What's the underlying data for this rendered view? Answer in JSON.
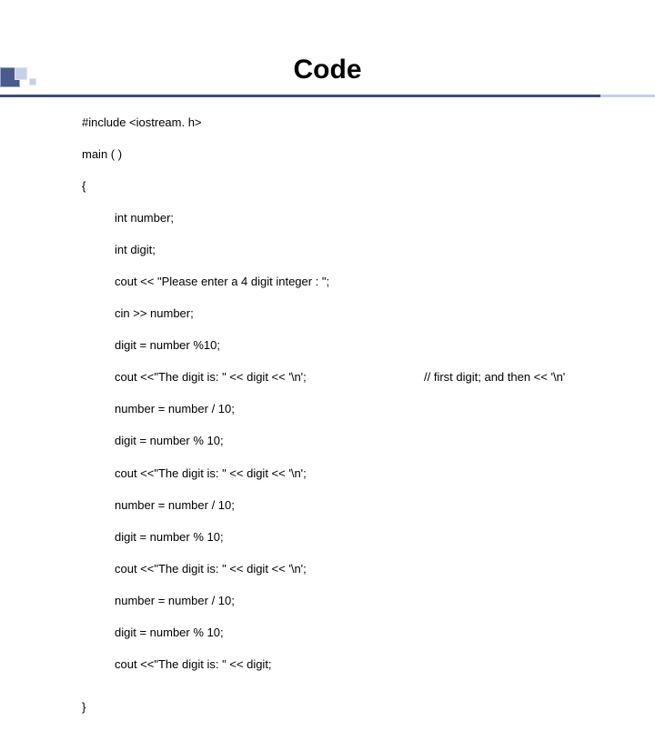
{
  "title": "Code",
  "code": {
    "l00": "#include <iostream. h>",
    "l01": "main ( )",
    "l02": "{",
    "l03": "int number;",
    "l04": "int digit;",
    "l05": "cout << \"Please enter a 4 digit integer : \";",
    "l06": "cin >> number;",
    "l07": "digit = number %10;",
    "l08": "cout <<\"The digit is: \" << digit << '\\n';",
    "l08c": "// first digit; and then << '\\n'",
    "l09": "number = number / 10;",
    "l10": "digit = number % 10;",
    "l11": "cout <<\"The digit is: \" << digit << '\\n';",
    "l12": "number = number / 10;",
    "l13": "digit = number % 10;",
    "l14": "cout <<\"The digit is: \" << digit << '\\n';",
    "l15": "number = number / 10;",
    "l16": "digit = number % 10;",
    "l17": "cout <<\"The digit is: \" << digit;",
    "l18": "}"
  }
}
